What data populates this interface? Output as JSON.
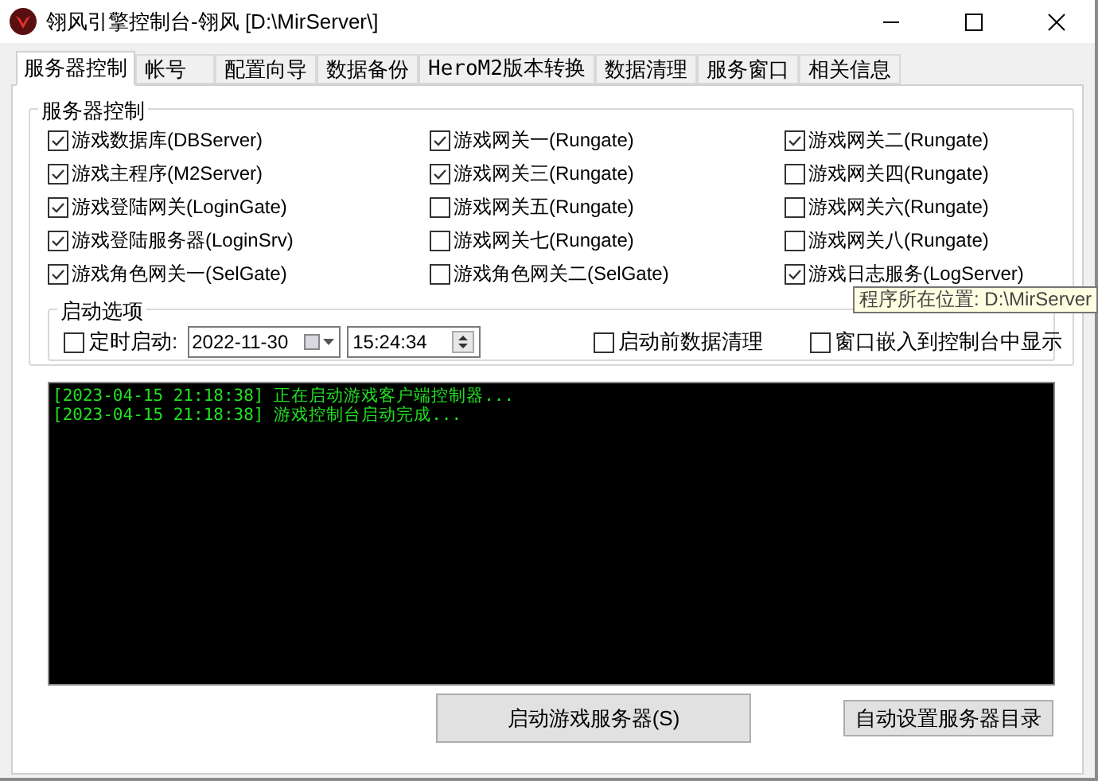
{
  "window": {
    "title": "翎风引擎控制台-翎风 [D:\\MirServer\\]"
  },
  "tabs": [
    {
      "label": "服务器控制",
      "selected": true
    },
    {
      "label": "帐号",
      "selected": false
    },
    {
      "label": "配置向导",
      "selected": false
    },
    {
      "label": "数据备份",
      "selected": false
    },
    {
      "label": "HeroM2版本转换",
      "selected": false
    },
    {
      "label": "数据清理",
      "selected": false
    },
    {
      "label": "服务窗口",
      "selected": false
    },
    {
      "label": "相关信息",
      "selected": false
    }
  ],
  "server_group": {
    "title": "服务器控制",
    "checkboxes": [
      {
        "label": "游戏数据库(DBServer)",
        "checked": true
      },
      {
        "label": "游戏网关一(Rungate)",
        "checked": true
      },
      {
        "label": "游戏网关二(Rungate)",
        "checked": true
      },
      {
        "label": "游戏主程序(M2Server)",
        "checked": true
      },
      {
        "label": "游戏网关三(Rungate)",
        "checked": true
      },
      {
        "label": "游戏网关四(Rungate)",
        "checked": false
      },
      {
        "label": "游戏登陆网关(LoginGate)",
        "checked": true
      },
      {
        "label": "游戏网关五(Rungate)",
        "checked": false
      },
      {
        "label": "游戏网关六(Rungate)",
        "checked": false
      },
      {
        "label": "游戏登陆服务器(LoginSrv)",
        "checked": true
      },
      {
        "label": "游戏网关七(Rungate)",
        "checked": false
      },
      {
        "label": "游戏网关八(Rungate)",
        "checked": false
      },
      {
        "label": "游戏角色网关一(SelGate)",
        "checked": true
      },
      {
        "label": "游戏角色网关二(SelGate)",
        "checked": false
      },
      {
        "label": "游戏日志服务(LogServer)",
        "checked": true
      }
    ]
  },
  "startup_options": {
    "title": "启动选项",
    "timed_start": {
      "label": "定时启动:",
      "checked": false
    },
    "date": "2022-11-30",
    "time": "15:24:34",
    "clean_before_start": {
      "label": "启动前数据清理",
      "checked": false
    },
    "embed_windows": {
      "label": "窗口嵌入到控制台中显示",
      "checked": false
    }
  },
  "log": [
    "[2023-04-15 21:18:38] 正在启动游戏客户端控制器...",
    "[2023-04-15 21:18:38] 游戏控制台启动完成..."
  ],
  "buttons": {
    "start": "启动游戏服务器(S)",
    "auto_dir": "自动设置服务器目录"
  },
  "tooltip": "程序所在位置: D:\\MirServer"
}
